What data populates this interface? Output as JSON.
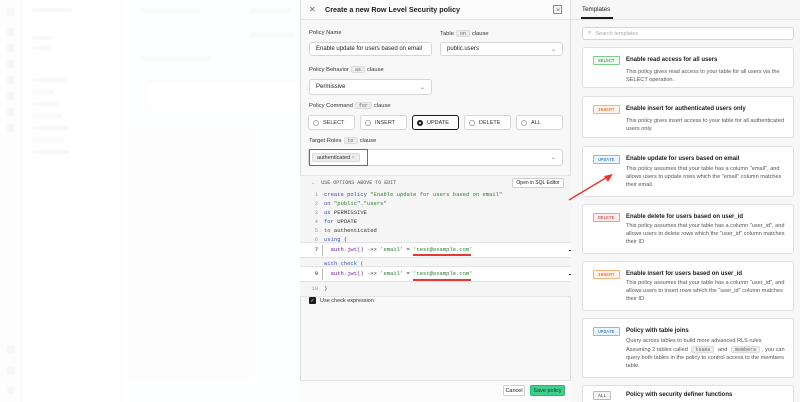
{
  "editor": {
    "title": "Create a new Row Level Security policy",
    "policy_name_label": "Policy Name",
    "policy_name_value": "Enable update for users based on email",
    "table_label": "Table",
    "table_chip": "on",
    "table_suffix": "clause",
    "table_value": "public.users",
    "behavior_label": "Policy Behavior",
    "behavior_chip": "as",
    "behavior_suffix": "clause",
    "behavior_value": "Permissive",
    "command_label": "Policy Command",
    "command_chip": "for",
    "command_suffix": "clause",
    "commands": [
      "SELECT",
      "INSERT",
      "UPDATE",
      "DELETE",
      "ALL"
    ],
    "commands_selected": "UPDATE",
    "roles_label": "Target Roles",
    "roles_chip": "to",
    "roles_suffix": "clause",
    "role_tag": "authenticated",
    "code_header": "USE OPTIONS ABOVE TO EDIT",
    "open_sql_label": "Open in SQL Editor",
    "code": {
      "l1_kw1": "create",
      "l1_kw2": "policy",
      "l1_str": "\"Enable update for users based on email\"",
      "l2_kw": "on",
      "l2_str": "\"public\".\"users\"",
      "l3_kw": "as",
      "l3_plain": "PERMISSIVE",
      "l4_kw": "for",
      "l4_plain": "UPDATE",
      "l5_kw": "to",
      "l5_plain": "authenticated",
      "l6_kw": "using",
      "l6_plain": "(",
      "l7_fn": "auth.jwt()",
      "l7_op": " ->> ",
      "l7_str1": "'email'",
      "l7_eq": " = ",
      "l7_str2": "'test@example.com'",
      "with_check": "with check (",
      "l9_fn": "auth.jwt()",
      "l9_op": " ->> ",
      "l9_str1": "'email'",
      "l9_eq": " = ",
      "l9_str2": "'test@example.com'",
      "l10_plain": ")"
    },
    "line_numbers": [
      "1",
      "2",
      "3",
      "4",
      "5",
      "6",
      "7",
      "9",
      "10"
    ],
    "check_expression_label": "Use check expression",
    "cancel_label": "Cancel",
    "save_label": "Save policy"
  },
  "templates": {
    "tab_label": "Templates",
    "search_placeholder": "Search templates",
    "cards": [
      {
        "badge": "SELECT",
        "title": "Enable read access for all users",
        "desc": "This policy gives read access to your table for all users via the SELECT operation."
      },
      {
        "badge": "INSERT",
        "title": "Enable insert for authenticated users only",
        "desc": "This policy gives insert access to your table for all authenticated users only."
      },
      {
        "badge": "UPDATE",
        "title": "Enable update for users based on email",
        "desc": "This policy assumes that your table has a column \"email\", and allows users to update rows which the \"email\" column matches their email."
      },
      {
        "badge": "DELETE",
        "title": "Enable delete for users based on user_id",
        "desc": "This policy assumes that your table has a column \"user_id\", and allows users to delete rows which the \"user_id\" column matches their ID"
      },
      {
        "badge": "INSERT",
        "title": "Enable insert for users based on user_id",
        "desc": "This policy assumes that your table has a column \"user_id\", and allows users to insert rows which the \"user_id\" column matches their ID"
      },
      {
        "badge": "UPDATE",
        "title": "Policy with table joins",
        "desc": "Query across tables to build more advanced RLS rules",
        "desc2a": "Assuming 2 tables called",
        "desc2b": "teams",
        "desc2c": "and",
        "desc2d": "members",
        "desc2e": ", you can query both tables in the policy to control access to the members table."
      },
      {
        "badge": "ALL",
        "title": "Policy with security definer functions"
      }
    ]
  },
  "colors": {
    "accent_green": "#3ecf8e",
    "highlight_red": "#e53935"
  }
}
